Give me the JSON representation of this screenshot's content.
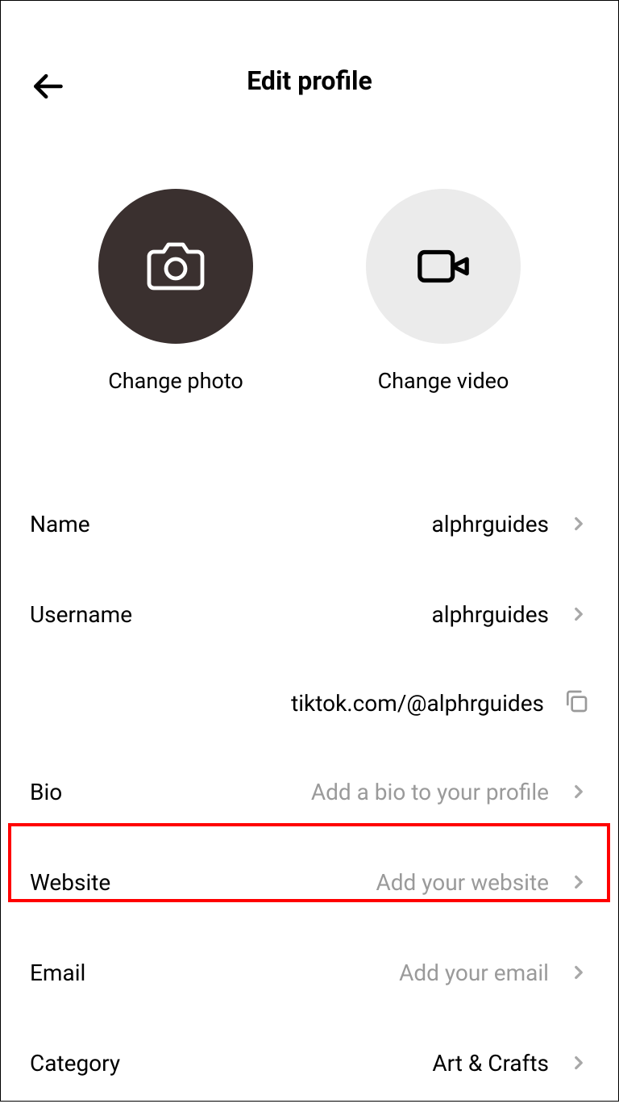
{
  "header": {
    "title": "Edit profile"
  },
  "media": {
    "photo_label": "Change photo",
    "video_label": "Change video"
  },
  "fields": {
    "name": {
      "label": "Name",
      "value": "alphrguides"
    },
    "username": {
      "label": "Username",
      "value": "alphrguides"
    },
    "profile_url": "tiktok.com/@alphrguides",
    "bio": {
      "label": "Bio",
      "placeholder": "Add a bio to your profile"
    },
    "website": {
      "label": "Website",
      "placeholder": "Add your website"
    },
    "email": {
      "label": "Email",
      "placeholder": "Add your email"
    },
    "category": {
      "label": "Category",
      "value": "Art & Crafts"
    }
  }
}
